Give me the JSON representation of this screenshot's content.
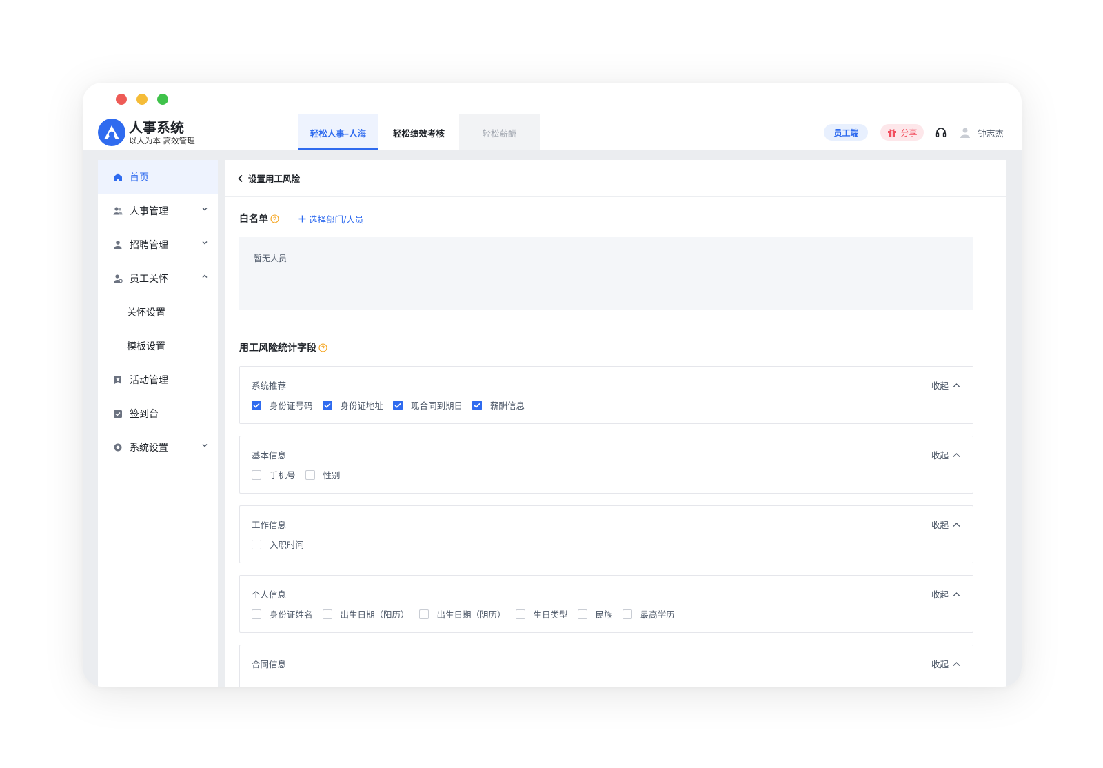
{
  "app": {
    "title": "人事系统",
    "subtitle": "以人为本 高效管理"
  },
  "tabs": [
    {
      "label": "轻松人事–人海",
      "state": "active"
    },
    {
      "label": "轻松绩效考核",
      "state": "normal"
    },
    {
      "label": "轻松薪酬",
      "state": "disabled"
    }
  ],
  "header": {
    "employee_label": "员工端",
    "share_label": "分享",
    "user_name": "钟志杰"
  },
  "sidebar": {
    "items": [
      {
        "label": "首页",
        "icon": "home-icon"
      },
      {
        "label": "人事管理",
        "icon": "people-icon"
      },
      {
        "label": "招聘管理",
        "icon": "person-icon"
      },
      {
        "label": "员工关怀",
        "icon": "care-icon"
      },
      {
        "label": "关怀设置"
      },
      {
        "label": "模板设置"
      },
      {
        "label": "活动管理",
        "icon": "bookmark-icon"
      },
      {
        "label": "签到台",
        "icon": "checkin-icon"
      },
      {
        "label": "系统设置",
        "icon": "settings-icon"
      }
    ]
  },
  "page": {
    "breadcrumb": "设置用工风险",
    "whitelist_title": "白名单",
    "add_link": "选择部门/人员",
    "whitelist_empty": "暂无人员",
    "fields_title": "用工风险统计字段",
    "collapse_label": "收起"
  },
  "groups": [
    {
      "title": "系统推荐",
      "items": [
        {
          "label": "身份证号码",
          "checked": true
        },
        {
          "label": "身份证地址",
          "checked": true
        },
        {
          "label": "现合同到期日",
          "checked": true
        },
        {
          "label": "薪酬信息",
          "checked": true
        }
      ]
    },
    {
      "title": "基本信息",
      "items": [
        {
          "label": "手机号",
          "checked": false
        },
        {
          "label": "性别",
          "checked": false
        }
      ]
    },
    {
      "title": "工作信息",
      "items": [
        {
          "label": "入职时间",
          "checked": false
        }
      ]
    },
    {
      "title": "个人信息",
      "items": [
        {
          "label": "身份证姓名",
          "checked": false
        },
        {
          "label": "出生日期（阳历）",
          "checked": false
        },
        {
          "label": "出生日期（阴历）",
          "checked": false
        },
        {
          "label": "生日类型",
          "checked": false
        },
        {
          "label": "民族",
          "checked": false
        },
        {
          "label": "最高学历",
          "checked": false
        }
      ]
    },
    {
      "title": "合同信息",
      "items": []
    }
  ],
  "colors": {
    "accent": "#2f6bef",
    "share_pink": "#f24e5e",
    "help_orange": "#f5a623"
  }
}
